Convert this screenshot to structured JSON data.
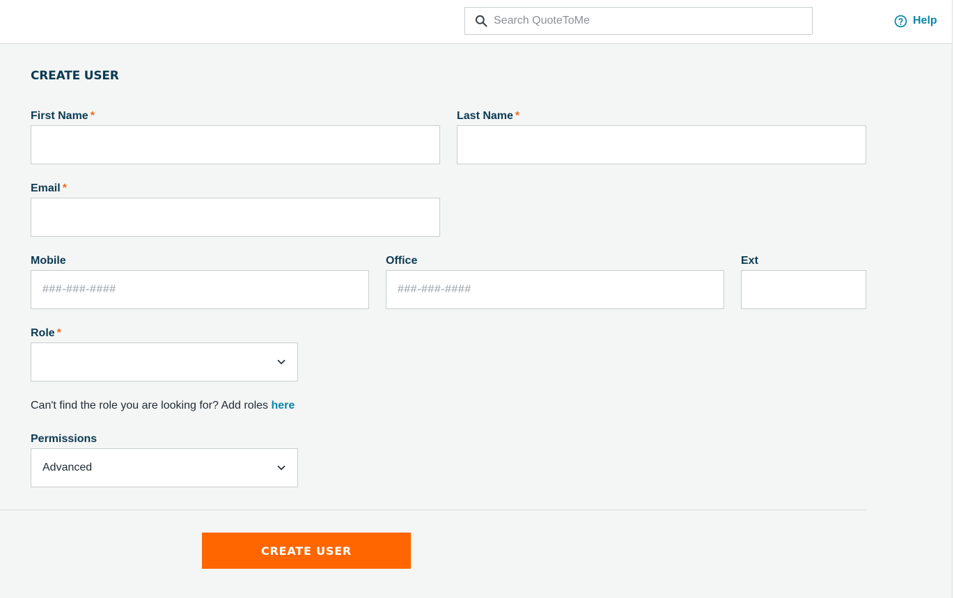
{
  "header": {
    "search_placeholder": "Search QuoteToMe",
    "help_label": "Help"
  },
  "form": {
    "title": "CREATE USER",
    "required_marker": "*",
    "first_name": {
      "label": "First Name",
      "value": ""
    },
    "last_name": {
      "label": "Last Name",
      "value": ""
    },
    "email": {
      "label": "Email",
      "value": ""
    },
    "mobile": {
      "label": "Mobile",
      "placeholder": "###-###-####",
      "value": ""
    },
    "office": {
      "label": "Office",
      "placeholder": "###-###-####",
      "value": ""
    },
    "ext": {
      "label": "Ext",
      "value": ""
    },
    "role": {
      "label": "Role",
      "selected": ""
    },
    "role_hint": {
      "text": "Can't find the role you are looking for? Add roles ",
      "link": "here"
    },
    "permissions": {
      "label": "Permissions",
      "selected": "Advanced"
    },
    "submit_label": "CREATE USER"
  },
  "colors": {
    "accent": "#ff6600",
    "link": "#0a87a8",
    "label": "#0b3a52",
    "required": "#f26a1b",
    "background": "#f4f5f5"
  },
  "icons": {
    "search": "search-icon",
    "help": "help-circle-icon",
    "dropdown": "chevron-down-icon"
  }
}
